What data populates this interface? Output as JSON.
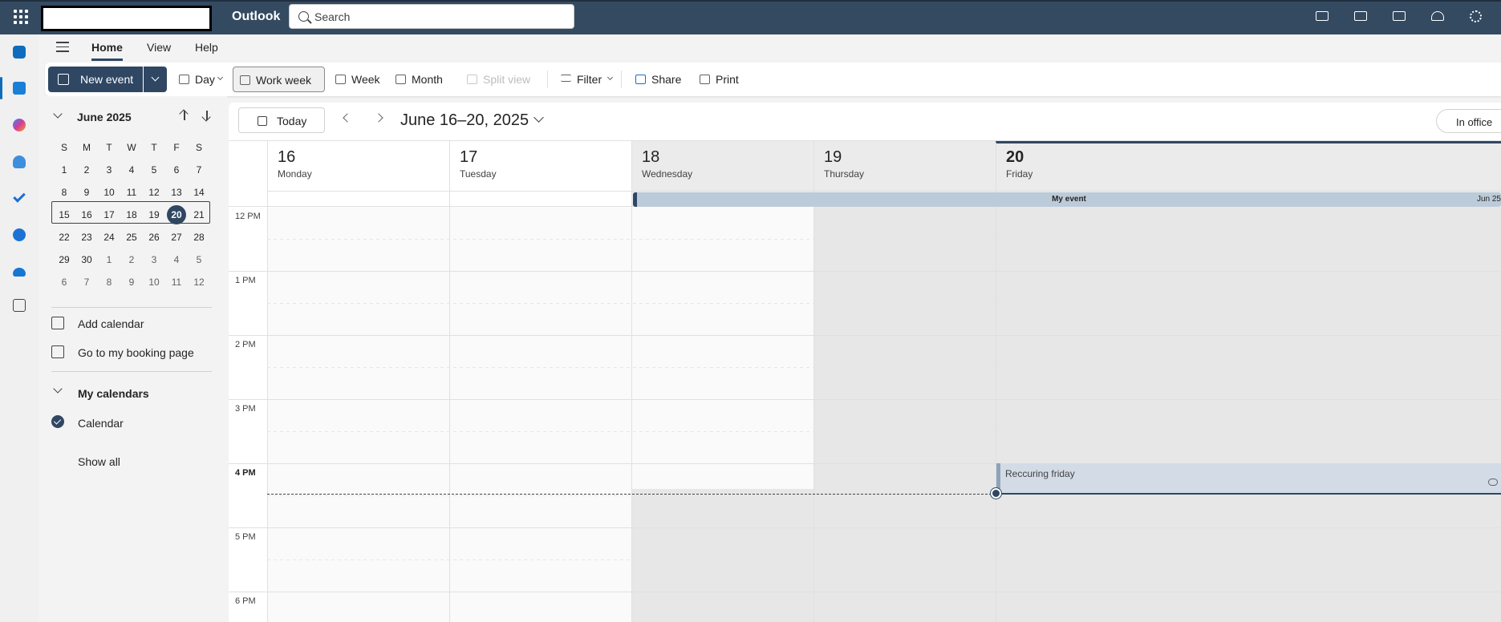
{
  "app": {
    "title": "Outlook",
    "search_placeholder": "Search"
  },
  "colors": {
    "topbar": "#344a61",
    "accent": "#2f4763",
    "busy_shade": "#e7e7e7",
    "event_fill": "#bccbd9"
  },
  "top_icons": [
    "feedback-icon",
    "word-icon",
    "todo-icon",
    "bell-icon",
    "gear-icon"
  ],
  "rail": [
    "mail-icon",
    "calendar-icon",
    "copilot-icon",
    "people-icon",
    "todo-check-icon",
    "org-explorer-icon",
    "onedrive-icon",
    "more-apps-icon"
  ],
  "ribbon": {
    "tabs": [
      "Home",
      "View",
      "Help"
    ]
  },
  "toolbar": {
    "new_event": "New event",
    "day": "Day",
    "work_week": "Work week",
    "week": "Week",
    "month": "Month",
    "split_view": "Split view",
    "filter": "Filter",
    "share": "Share",
    "print": "Print"
  },
  "mini_calendar": {
    "title": "June 2025",
    "dow": [
      "S",
      "M",
      "T",
      "W",
      "T",
      "F",
      "S"
    ],
    "weeks": [
      [
        "1",
        "2",
        "3",
        "4",
        "5",
        "6",
        "7"
      ],
      [
        "8",
        "9",
        "10",
        "11",
        "12",
        "13",
        "14"
      ],
      [
        "15",
        "16",
        "17",
        "18",
        "19",
        "20",
        "21"
      ],
      [
        "22",
        "23",
        "24",
        "25",
        "26",
        "27",
        "28"
      ],
      [
        "29",
        "30",
        "1",
        "2",
        "3",
        "4",
        "5"
      ],
      [
        "6",
        "7",
        "8",
        "9",
        "10",
        "11",
        "12"
      ]
    ],
    "today": "20"
  },
  "nav": {
    "add_calendar": "Add calendar",
    "booking_page": "Go to my booking page",
    "my_calendars": "My calendars",
    "calendar": "Calendar",
    "show_all": "Show all"
  },
  "calendar": {
    "today_label": "Today",
    "date_range": "June 16–20, 2025",
    "status": "In office",
    "days": [
      {
        "num": "16",
        "name": "Monday"
      },
      {
        "num": "17",
        "name": "Tuesday"
      },
      {
        "num": "18",
        "name": "Wednesday"
      },
      {
        "num": "19",
        "name": "Thursday"
      },
      {
        "num": "20",
        "name": "Friday"
      }
    ],
    "hours": [
      "12 PM",
      "1 PM",
      "2 PM",
      "3 PM",
      "4 PM",
      "5 PM",
      "6 PM"
    ],
    "all_day_event": {
      "title": "My event",
      "end": "Jun 25"
    },
    "events": [
      {
        "title": "Reccuring friday"
      }
    ]
  }
}
